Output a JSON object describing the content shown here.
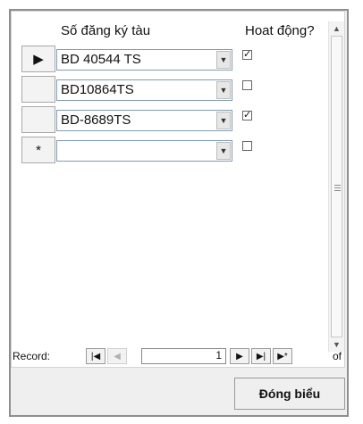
{
  "form": {
    "columns": {
      "vessel_reg_no": "Số đăng ký tàu",
      "active": "Hoat động?"
    },
    "rows": [
      {
        "selector": "▶",
        "vessel": "BD 40544 TS",
        "active": true
      },
      {
        "selector": "",
        "vessel": "BD10864TS",
        "active": false
      },
      {
        "selector": "",
        "vessel": "BD-8689TS",
        "active": true
      },
      {
        "selector": "*",
        "vessel": "",
        "active": false
      }
    ]
  },
  "navigation": {
    "label": "Record:",
    "current": "1",
    "of_label": "of",
    "icons": [
      "first-record-icon",
      "prev-record-icon",
      "next-record-icon",
      "last-record-icon",
      "new-record-icon"
    ]
  },
  "actions": {
    "close_form_label": "Đóng biểu"
  }
}
